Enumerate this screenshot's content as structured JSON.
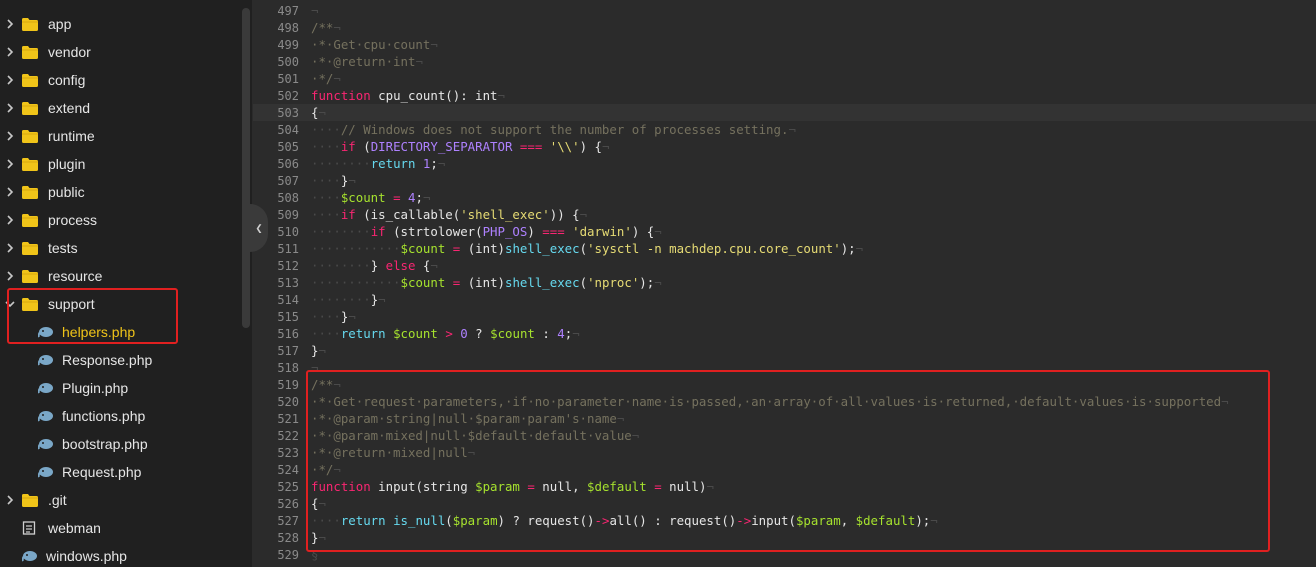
{
  "sidebar": {
    "items": [
      {
        "label": "app",
        "type": "folder",
        "expanded": false
      },
      {
        "label": "vendor",
        "type": "folder",
        "expanded": false
      },
      {
        "label": "config",
        "type": "folder",
        "expanded": false
      },
      {
        "label": "extend",
        "type": "folder",
        "expanded": false
      },
      {
        "label": "runtime",
        "type": "folder",
        "expanded": false
      },
      {
        "label": "plugin",
        "type": "folder",
        "expanded": false
      },
      {
        "label": "public",
        "type": "folder",
        "expanded": false
      },
      {
        "label": "process",
        "type": "folder",
        "expanded": false
      },
      {
        "label": "tests",
        "type": "folder",
        "expanded": false
      },
      {
        "label": "resource",
        "type": "folder",
        "expanded": false
      },
      {
        "label": "support",
        "type": "folder",
        "expanded": true
      },
      {
        "label": "helpers.php",
        "type": "php",
        "active": true
      },
      {
        "label": "Response.php",
        "type": "php"
      },
      {
        "label": "Plugin.php",
        "type": "php"
      },
      {
        "label": "functions.php",
        "type": "php"
      },
      {
        "label": "bootstrap.php",
        "type": "php"
      },
      {
        "label": "Request.php",
        "type": "php"
      },
      {
        "label": ".git",
        "type": "folder",
        "expanded": false
      },
      {
        "label": "webman",
        "type": "file"
      },
      {
        "label": "windows.php",
        "type": "php-root"
      }
    ]
  },
  "editor": {
    "current_line": "503",
    "lines": [
      {
        "n": "497",
        "t": [
          [
            "ws",
            "¬"
          ]
        ]
      },
      {
        "n": "498",
        "t": [
          [
            "cm",
            "/**"
          ],
          [
            "ws",
            "¬"
          ]
        ]
      },
      {
        "n": "499",
        "t": [
          [
            "cm",
            "·*·Get·cpu·count"
          ],
          [
            "ws",
            "¬"
          ]
        ]
      },
      {
        "n": "500",
        "t": [
          [
            "cm",
            "·*·@return·int"
          ],
          [
            "ws",
            "¬"
          ]
        ]
      },
      {
        "n": "501",
        "t": [
          [
            "cm",
            "·*/"
          ],
          [
            "ws",
            "¬"
          ]
        ]
      },
      {
        "n": "502",
        "t": [
          [
            "kw",
            "function"
          ],
          [
            "code",
            " cpu_count(): int"
          ],
          [
            "ws",
            "¬"
          ]
        ]
      },
      {
        "n": "503",
        "t": [
          [
            "code",
            "{"
          ],
          [
            "ws",
            "¬"
          ]
        ]
      },
      {
        "n": "504",
        "t": [
          [
            "ws",
            "····"
          ],
          [
            "cm",
            "// Windows does not support the number of processes setting."
          ],
          [
            "ws",
            "¬"
          ]
        ]
      },
      {
        "n": "505",
        "t": [
          [
            "ws",
            "····"
          ],
          [
            "kw",
            "if"
          ],
          [
            "code",
            " ("
          ],
          [
            "cls",
            "DIRECTORY_SEPARATOR"
          ],
          [
            "code",
            " "
          ],
          [
            "kw",
            "==="
          ],
          [
            "code",
            " "
          ],
          [
            "str",
            "'\\\\'"
          ],
          [
            "code",
            ") {"
          ],
          [
            "ws",
            "¬"
          ]
        ]
      },
      {
        "n": "506",
        "t": [
          [
            "ws",
            "········"
          ],
          [
            "fn",
            "return"
          ],
          [
            "code",
            " "
          ],
          [
            "num",
            "1"
          ],
          [
            "code",
            ";"
          ],
          [
            "ws",
            "¬"
          ]
        ]
      },
      {
        "n": "507",
        "t": [
          [
            "ws",
            "····"
          ],
          [
            "code",
            "}"
          ],
          [
            "ws",
            "¬"
          ]
        ]
      },
      {
        "n": "508",
        "t": [
          [
            "ws",
            "····"
          ],
          [
            "var",
            "$count"
          ],
          [
            "code",
            " "
          ],
          [
            "kw",
            "="
          ],
          [
            "code",
            " "
          ],
          [
            "num",
            "4"
          ],
          [
            "code",
            ";"
          ],
          [
            "ws",
            "¬"
          ]
        ]
      },
      {
        "n": "509",
        "t": [
          [
            "ws",
            "····"
          ],
          [
            "kw",
            "if"
          ],
          [
            "code",
            " (is_callable("
          ],
          [
            "str",
            "'shell_exec'"
          ],
          [
            "code",
            ")) {"
          ],
          [
            "ws",
            "¬"
          ]
        ]
      },
      {
        "n": "510",
        "t": [
          [
            "ws",
            "········"
          ],
          [
            "kw",
            "if"
          ],
          [
            "code",
            " (strtolower("
          ],
          [
            "cls",
            "PHP_OS"
          ],
          [
            "code",
            ") "
          ],
          [
            "kw",
            "==="
          ],
          [
            "code",
            " "
          ],
          [
            "str",
            "'darwin'"
          ],
          [
            "code",
            ") {"
          ],
          [
            "ws",
            "¬"
          ]
        ]
      },
      {
        "n": "511",
        "t": [
          [
            "ws",
            "············"
          ],
          [
            "var",
            "$count"
          ],
          [
            "code",
            " "
          ],
          [
            "kw",
            "="
          ],
          [
            "code",
            " (int)"
          ],
          [
            "fn",
            "shell_exec"
          ],
          [
            "code",
            "("
          ],
          [
            "str",
            "'sysctl -n machdep.cpu.core_count'"
          ],
          [
            "code",
            ");"
          ],
          [
            "ws",
            "¬"
          ]
        ]
      },
      {
        "n": "512",
        "t": [
          [
            "ws",
            "········"
          ],
          [
            "code",
            "} "
          ],
          [
            "kw",
            "else"
          ],
          [
            "code",
            " {"
          ],
          [
            "ws",
            "¬"
          ]
        ]
      },
      {
        "n": "513",
        "t": [
          [
            "ws",
            "············"
          ],
          [
            "var",
            "$count"
          ],
          [
            "code",
            " "
          ],
          [
            "kw",
            "="
          ],
          [
            "code",
            " (int)"
          ],
          [
            "fn",
            "shell_exec"
          ],
          [
            "code",
            "("
          ],
          [
            "str",
            "'nproc'"
          ],
          [
            "code",
            ");"
          ],
          [
            "ws",
            "¬"
          ]
        ]
      },
      {
        "n": "514",
        "t": [
          [
            "ws",
            "········"
          ],
          [
            "code",
            "}"
          ],
          [
            "ws",
            "¬"
          ]
        ]
      },
      {
        "n": "515",
        "t": [
          [
            "ws",
            "····"
          ],
          [
            "code",
            "}"
          ],
          [
            "ws",
            "¬"
          ]
        ]
      },
      {
        "n": "516",
        "t": [
          [
            "ws",
            "····"
          ],
          [
            "fn",
            "return"
          ],
          [
            "code",
            " "
          ],
          [
            "var",
            "$count"
          ],
          [
            "code",
            " "
          ],
          [
            "kw",
            ">"
          ],
          [
            "code",
            " "
          ],
          [
            "num",
            "0"
          ],
          [
            "code",
            " ? "
          ],
          [
            "var",
            "$count"
          ],
          [
            "code",
            " : "
          ],
          [
            "num",
            "4"
          ],
          [
            "code",
            ";"
          ],
          [
            "ws",
            "¬"
          ]
        ]
      },
      {
        "n": "517",
        "t": [
          [
            "code",
            "}"
          ],
          [
            "ws",
            "¬"
          ]
        ]
      },
      {
        "n": "518",
        "t": [
          [
            "ws",
            "¬"
          ]
        ]
      },
      {
        "n": "519",
        "t": [
          [
            "cm",
            "/**"
          ],
          [
            "ws",
            "¬"
          ]
        ]
      },
      {
        "n": "520",
        "t": [
          [
            "cm",
            "·*·Get·request·parameters,·if·no·parameter·name·is·passed,·an·array·of·all·values·is·returned,·default·values·is·supported"
          ],
          [
            "ws",
            "¬"
          ]
        ]
      },
      {
        "n": "521",
        "t": [
          [
            "cm",
            "·*·@param·string|null·$param·param's·name"
          ],
          [
            "ws",
            "¬"
          ]
        ]
      },
      {
        "n": "522",
        "t": [
          [
            "cm",
            "·*·@param·mixed|null·$default·default·value"
          ],
          [
            "ws",
            "¬"
          ]
        ]
      },
      {
        "n": "523",
        "t": [
          [
            "cm",
            "·*·@return·mixed|null"
          ],
          [
            "ws",
            "¬"
          ]
        ]
      },
      {
        "n": "524",
        "t": [
          [
            "cm",
            "·*/"
          ],
          [
            "ws",
            "¬"
          ]
        ]
      },
      {
        "n": "525",
        "t": [
          [
            "kw",
            "function"
          ],
          [
            "code",
            " input(string "
          ],
          [
            "var",
            "$param"
          ],
          [
            "code",
            " "
          ],
          [
            "kw",
            "="
          ],
          [
            "code",
            " null, "
          ],
          [
            "var",
            "$default"
          ],
          [
            "code",
            " "
          ],
          [
            "kw",
            "="
          ],
          [
            "code",
            " null)"
          ],
          [
            "ws",
            "¬"
          ]
        ]
      },
      {
        "n": "526",
        "t": [
          [
            "code",
            "{"
          ],
          [
            "ws",
            "¬"
          ]
        ]
      },
      {
        "n": "527",
        "t": [
          [
            "ws",
            "····"
          ],
          [
            "fn",
            "return"
          ],
          [
            "code",
            " "
          ],
          [
            "fn",
            "is_null"
          ],
          [
            "code",
            "("
          ],
          [
            "var",
            "$param"
          ],
          [
            "code",
            ") ? request()"
          ],
          [
            "kw",
            "->"
          ],
          [
            "code",
            "all() : request()"
          ],
          [
            "kw",
            "->"
          ],
          [
            "code",
            "input("
          ],
          [
            "var",
            "$param"
          ],
          [
            "code",
            ", "
          ],
          [
            "var",
            "$default"
          ],
          [
            "code",
            ");"
          ],
          [
            "ws",
            "¬"
          ]
        ]
      },
      {
        "n": "528",
        "t": [
          [
            "code",
            "}"
          ],
          [
            "ws",
            "¬"
          ]
        ]
      },
      {
        "n": "529",
        "t": [
          [
            "ws",
            "§"
          ]
        ]
      }
    ]
  },
  "colors": {
    "highlight_box": "#e02020",
    "active_file": "#f0c419",
    "folder": "#f0c419"
  },
  "icons": {
    "folder": "folder-icon",
    "php": "php-elephant-icon",
    "file": "document-icon",
    "collapse": "chevron-left-icon"
  }
}
